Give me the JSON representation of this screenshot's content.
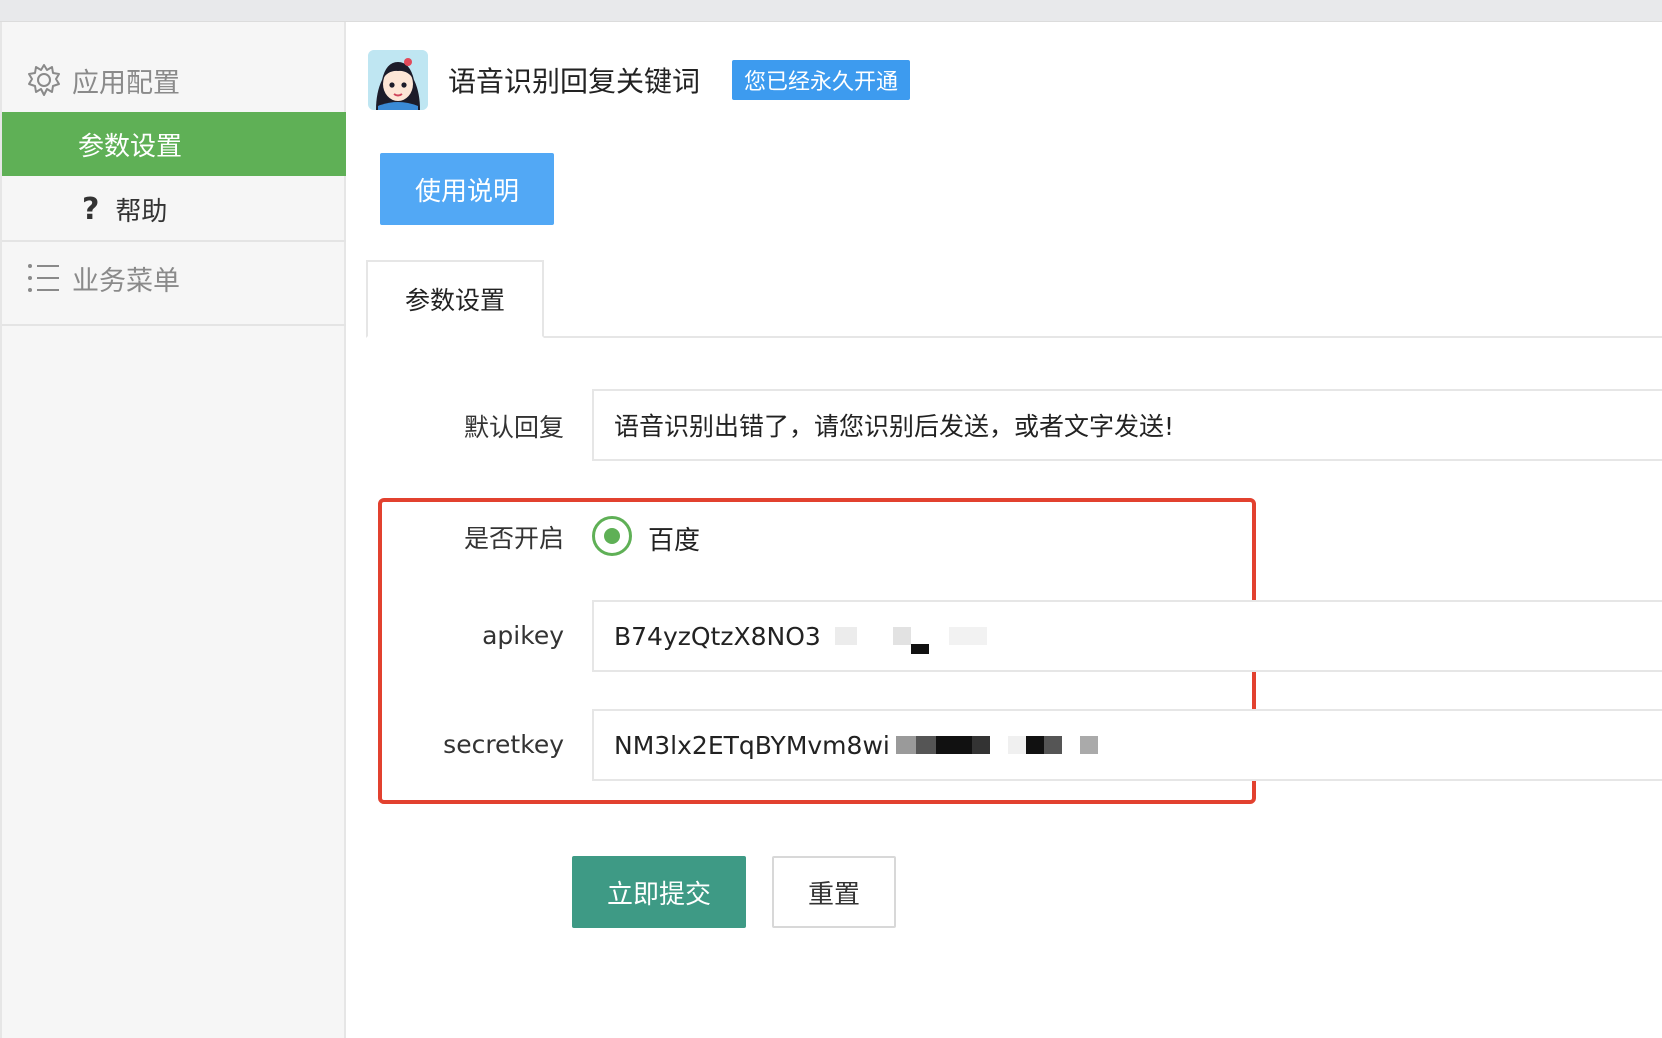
{
  "sidebar": {
    "config_label": "应用配置",
    "active_item": "参数设置",
    "help_label": "帮助",
    "help_glyph": "?",
    "menu_label": "业务菜单"
  },
  "header": {
    "app_title": "语音识别回复关键词",
    "badge": "您已经永久开通"
  },
  "guide_button": "使用说明",
  "tab": "参数设置",
  "form": {
    "default_reply_label": "默认回复",
    "default_reply_value": "语音识别出错了，请您识别后发送，或者文字发送!",
    "enable_label": "是否开启",
    "enable_option": "百度",
    "apikey_label": "apikey",
    "apikey_value": "B74yzQtzX8NO3",
    "secretkey_label": "secretkey",
    "secretkey_value": "NM3lx2ETqBYMvm8wi",
    "submit": "立即提交",
    "reset": "重置"
  },
  "colors": {
    "sidebar_active": "#5fb056",
    "badge": "#3d9bef",
    "guide_button": "#52a8f5",
    "submit_button": "#3e9a85",
    "highlight_border": "#e2412f"
  }
}
